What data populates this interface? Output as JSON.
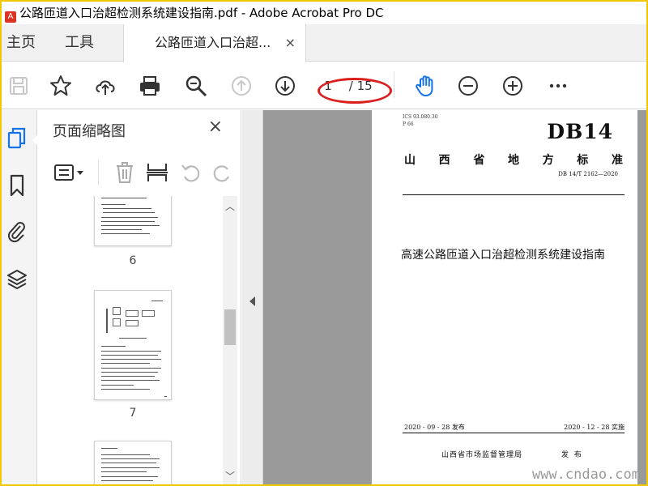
{
  "window": {
    "title": "公路匝道入口治超检测系统建设指南.pdf - Adobe Acrobat Pro DC"
  },
  "tabs": {
    "home": "主页",
    "tools": "工具",
    "document_tab": "公路匝道入口治超...",
    "close_glyph": "×"
  },
  "toolbar": {
    "icons": [
      "save-icon",
      "bookmark-star-icon",
      "upload-cloud-icon",
      "print-icon",
      "zoom-search-icon",
      "previous-page-icon",
      "next-page-icon",
      "hand-tool-icon",
      "zoom-out-icon",
      "zoom-in-icon",
      "more-icon"
    ],
    "page_current": "1",
    "page_total": "/ 15",
    "accent_color": "#1473e6",
    "annotation_color": "#d9201f"
  },
  "left_rail": {
    "icons": [
      "page-thumbnails-icon",
      "bookmark-icon",
      "attachment-icon",
      "layers-icon"
    ]
  },
  "thumbnail_panel": {
    "title": "页面缩略图",
    "close_glyph": "×",
    "tools": [
      "thumbnail-options-icon",
      "delete-page-icon",
      "crop-page-icon",
      "rotate-left-icon",
      "rotate-right-icon"
    ],
    "pages": [
      {
        "label": "6"
      },
      {
        "label": "7"
      },
      {
        "label": ""
      }
    ]
  },
  "document_page": {
    "ics": "ICS   93.080.30",
    "ccs": "P 66",
    "standard_code": "DB14",
    "province_chars": [
      "山",
      "西",
      "省",
      "地",
      "方",
      "标",
      "准"
    ],
    "standard_number": "DB 14/T  2162—2020",
    "title": "高速公路匝道入口治超检测系统建设指南",
    "issue_date": "2020 - 09 - 28 发布",
    "implement_date": "2020 - 12 - 28 实施",
    "authority": "山西省市场监督管理局",
    "publish": "发 布"
  },
  "watermark": "www.cndao.com"
}
